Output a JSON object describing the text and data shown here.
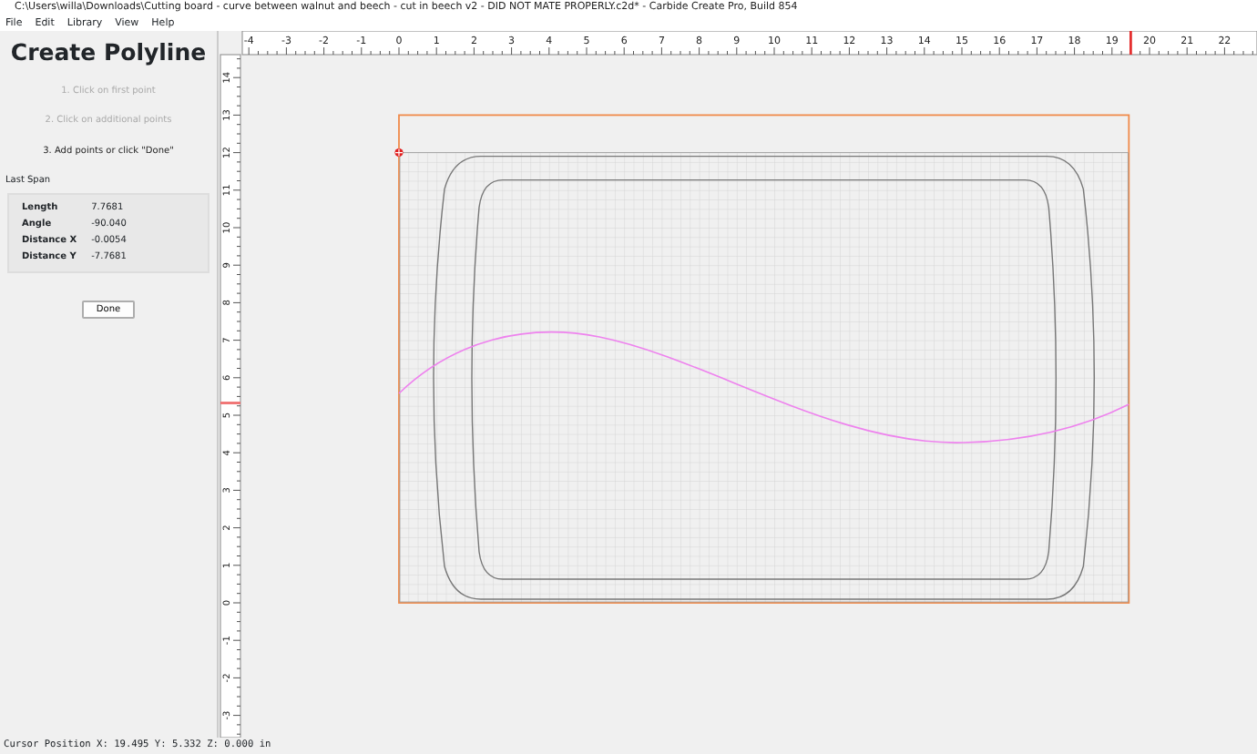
{
  "window": {
    "title": "C:\\Users\\willa\\Downloads\\Cutting board - curve between walnut and beech - cut in beech v2 - DID NOT MATE PROPERLY.c2d* - Carbide Create Pro, Build 854"
  },
  "menu": [
    {
      "label": "File"
    },
    {
      "label": "Edit"
    },
    {
      "label": "Library"
    },
    {
      "label": "View"
    },
    {
      "label": "Help"
    }
  ],
  "panel": {
    "title": "Create Polyline",
    "steps": [
      {
        "text": "1. Click on first point",
        "active": false
      },
      {
        "text": "2. Click on additional points",
        "active": false
      },
      {
        "text": "3. Add points or click \"Done\"",
        "active": true
      }
    ],
    "last_span": {
      "label": "Last Span",
      "rows": [
        {
          "name": "Length",
          "value": "7.7681"
        },
        {
          "name": "Angle",
          "value": "-90.040"
        },
        {
          "name": "Distance X",
          "value": "-0.0054"
        },
        {
          "name": "Distance Y",
          "value": "-7.7681"
        }
      ]
    },
    "done_button": "Done"
  },
  "rulers": {
    "horizontal": [
      "-4",
      "-3",
      "-2",
      "-1",
      "0",
      "1",
      "2",
      "3",
      "4",
      "5",
      "6",
      "7",
      "8",
      "9",
      "10",
      "11",
      "12",
      "13",
      "14",
      "15",
      "16",
      "17",
      "18",
      "19",
      "20",
      "21",
      "22"
    ],
    "vertical": [
      "14",
      "13",
      "12",
      "11",
      "10",
      "9",
      "8",
      "7",
      "6",
      "5",
      "4",
      "3",
      "2",
      "1",
      "0",
      "-1",
      "-2",
      "-3"
    ]
  },
  "status_bar": "Cursor Position X: 19.495 Y: 5.332 Z: 0.000 in"
}
